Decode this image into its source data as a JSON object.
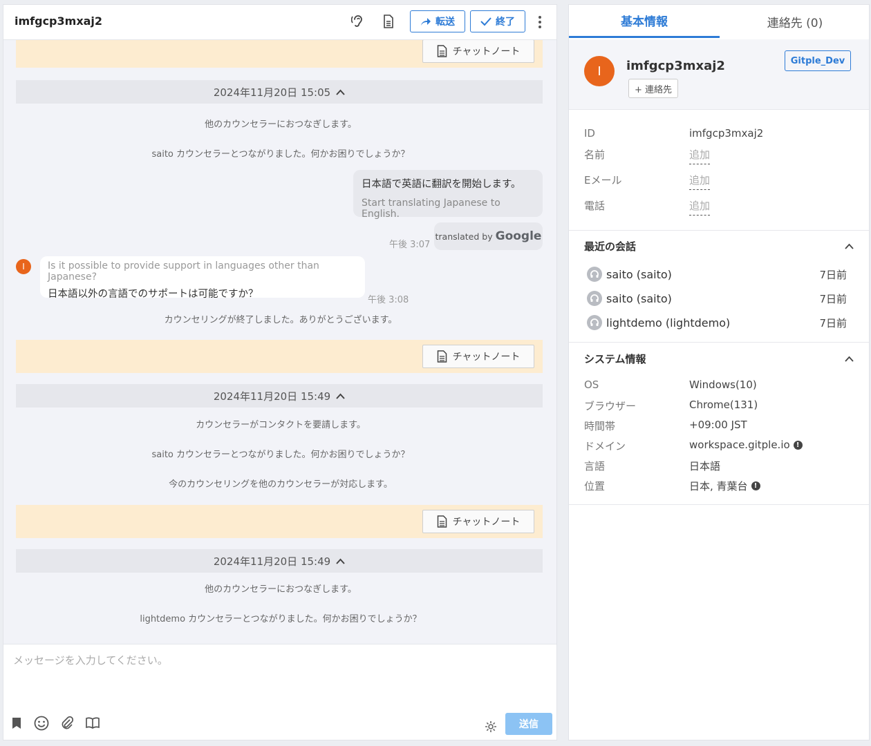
{
  "chat": {
    "title": "imfgcp3mxaj2",
    "header_buttons": {
      "transfer": "転送",
      "finish": "終了"
    },
    "note_label": "チャットノート",
    "sessions": [
      {
        "date": "2024年11月20日 15:05"
      },
      {
        "date": "2024年11月20日 15:49"
      },
      {
        "date": "2024年11月20日 15:49"
      }
    ],
    "messages": {
      "s1_sys1": "他のカウンセラーにおつなぎします。",
      "s1_sys2": "saito カウンセラーとつながりました。何かお困りでしょうか？",
      "out_ja": "日本語で英語に翻訳を開始します。",
      "out_en": "Start translating Japanese to English.",
      "translated_by": "translated by",
      "google": "Google",
      "out_time": "午後 3:07",
      "in_avatar": "I",
      "in_en": "Is it possible to provide support in languages other than Japanese?",
      "in_ja": "日本語以外の言語でのサポートは可能ですか？",
      "in_time": "午後 3:08",
      "s1_end": "カウンセリングが終了しました。ありがとうございます。",
      "s2_sys1": "カウンセラーがコンタクトを要請します。",
      "s2_sys2": "saito カウンセラーとつながりました。何かお困りでしょうか？",
      "s2_sys3": "今のカウンセリングを他のカウンセラーが対応します。",
      "s3_sys1": "他のカウンセラーにおつなぎします。",
      "s3_sys2": "lightdemo カウンセラーとつながりました。何かお困りでしょうか？"
    },
    "input_placeholder": "メッセージを入力してください。",
    "send_label": "送信"
  },
  "info": {
    "tabs": {
      "basic": "基本情報",
      "contacts": "連絡先 (0)"
    },
    "avatar_letter": "I",
    "name": "imfgcp3mxaj2",
    "add_contact": "+ 連絡先",
    "tag": "Gitple_Dev",
    "fields": {
      "id_label": "ID",
      "id_value": "imfgcp3mxaj2",
      "name_label": "名前",
      "email_label": "Eメール",
      "phone_label": "電話",
      "add_text": "追加"
    },
    "recent": {
      "title": "最近の会話",
      "items": [
        {
          "name": "saito (saito)",
          "time": "7日前"
        },
        {
          "name": "saito (saito)",
          "time": "7日前"
        },
        {
          "name": "lightdemo (lightdemo)",
          "time": "7日前"
        }
      ]
    },
    "system": {
      "title": "システム情報",
      "rows": [
        {
          "label": "OS",
          "value": "Windows(10)"
        },
        {
          "label": "ブラウザー",
          "value": "Chrome(131)"
        },
        {
          "label": "時間帯",
          "value": "+09:00 JST"
        },
        {
          "label": "ドメイン",
          "value": "workspace.gitple.io"
        },
        {
          "label": "言語",
          "value": "日本語"
        },
        {
          "label": "位置",
          "value": "日本, 青葉台"
        }
      ]
    }
  },
  "colors": {
    "accent": "#2d7bd6",
    "avatar": "#e8651c",
    "note_band": "#fdecd0",
    "send_disabled": "#8cc3f4"
  }
}
